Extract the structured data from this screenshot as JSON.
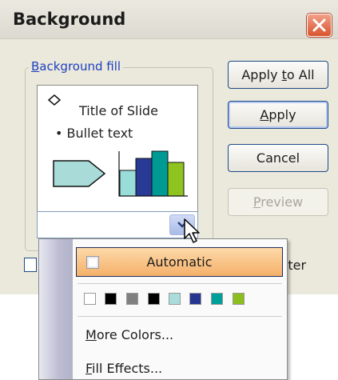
{
  "dialog": {
    "title": "Background",
    "close_icon": "close-x-icon"
  },
  "group": {
    "label_access": "B",
    "label_rest": "ackground fill"
  },
  "preview": {
    "title_text": "Title of Slide",
    "bullet_text": "Bullet text",
    "bar_colors": [
      "#99ddd8",
      "#283a96",
      "#009a94",
      "#8fc31f"
    ],
    "arrow_fill": "#a9dcd9"
  },
  "buttons": {
    "apply_all_pre": "Apply ",
    "apply_all_access": "t",
    "apply_all_post": "o All",
    "apply_access": "A",
    "apply_rest": "pply",
    "cancel": "Cancel",
    "preview_access": "P",
    "preview_rest": "review"
  },
  "omit_master": {
    "label_visible": "ster"
  },
  "dropdown": {
    "automatic": "Automatic",
    "swatches": [
      "#ffffff",
      "#000000",
      "#808080",
      "#000000",
      "#aadcdc",
      "#26358f",
      "#00a09a",
      "#8cbe1e"
    ],
    "more_colors_access": "M",
    "more_colors_rest": "ore Colors...",
    "fill_effects_access": "F",
    "fill_effects_rest": "ill Effects..."
  }
}
